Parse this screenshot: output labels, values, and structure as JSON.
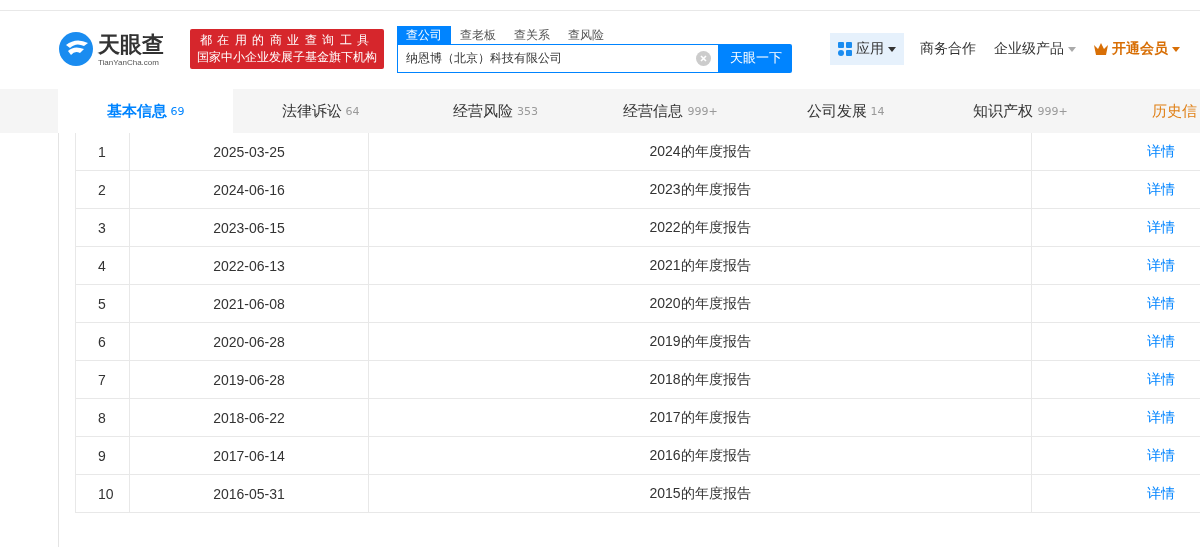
{
  "header": {
    "logo": {
      "name": "天眼查",
      "domain": "TianYanCha.com"
    },
    "banner": {
      "line_1": "都在用的商业查询工具",
      "line_2": "国家中小企业发展子基金旗下机构"
    },
    "search": {
      "tabs": [
        {
          "label": "查公司",
          "selected": true
        },
        {
          "label": "查老板",
          "selected": false
        },
        {
          "label": "查关系",
          "selected": false
        },
        {
          "label": "查风险",
          "selected": false
        }
      ],
      "value": "纳恩博（北京）科技有限公司",
      "button": "天眼一下"
    },
    "nav": [
      {
        "label": "应用",
        "kind": "apps",
        "selected": true
      },
      {
        "label": "商务合作",
        "kind": "plain",
        "selected": false
      },
      {
        "label": "企业级产品",
        "kind": "dropdown",
        "selected": false
      },
      {
        "label": "开通会员",
        "kind": "vip",
        "selected": false
      }
    ]
  },
  "tabs": [
    {
      "label": "基本信息",
      "count": "69",
      "selected": true,
      "kind": "normal"
    },
    {
      "label": "法律诉讼",
      "count": "64",
      "selected": false,
      "kind": "normal"
    },
    {
      "label": "经营风险",
      "count": "353",
      "selected": false,
      "kind": "normal"
    },
    {
      "label": "经营信息",
      "count": "999+",
      "selected": false,
      "kind": "normal"
    },
    {
      "label": "公司发展",
      "count": "14",
      "selected": false,
      "kind": "normal"
    },
    {
      "label": "知识产权",
      "count": "999+",
      "selected": false,
      "kind": "normal"
    },
    {
      "label": "历史信",
      "selected": false,
      "kind": "history"
    }
  ],
  "table": {
    "rows": [
      {
        "index": "1",
        "date": "2025-03-25",
        "report": "2024的年度报告",
        "action": "详情"
      },
      {
        "index": "2",
        "date": "2024-06-16",
        "report": "2023的年度报告",
        "action": "详情"
      },
      {
        "index": "3",
        "date": "2023-06-15",
        "report": "2022的年度报告",
        "action": "详情"
      },
      {
        "index": "4",
        "date": "2022-06-13",
        "report": "2021的年度报告",
        "action": "详情"
      },
      {
        "index": "5",
        "date": "2021-06-08",
        "report": "2020的年度报告",
        "action": "详情"
      },
      {
        "index": "6",
        "date": "2020-06-28",
        "report": "2019的年度报告",
        "action": "详情"
      },
      {
        "index": "7",
        "date": "2019-06-28",
        "report": "2018的年度报告",
        "action": "详情"
      },
      {
        "index": "8",
        "date": "2018-06-22",
        "report": "2017的年度报告",
        "action": "详情"
      },
      {
        "index": "9",
        "date": "2017-06-14",
        "report": "2016的年度报告",
        "action": "详情"
      },
      {
        "index": "10",
        "date": "2016-05-31",
        "report": "2015的年度报告",
        "action": "详情"
      }
    ]
  }
}
